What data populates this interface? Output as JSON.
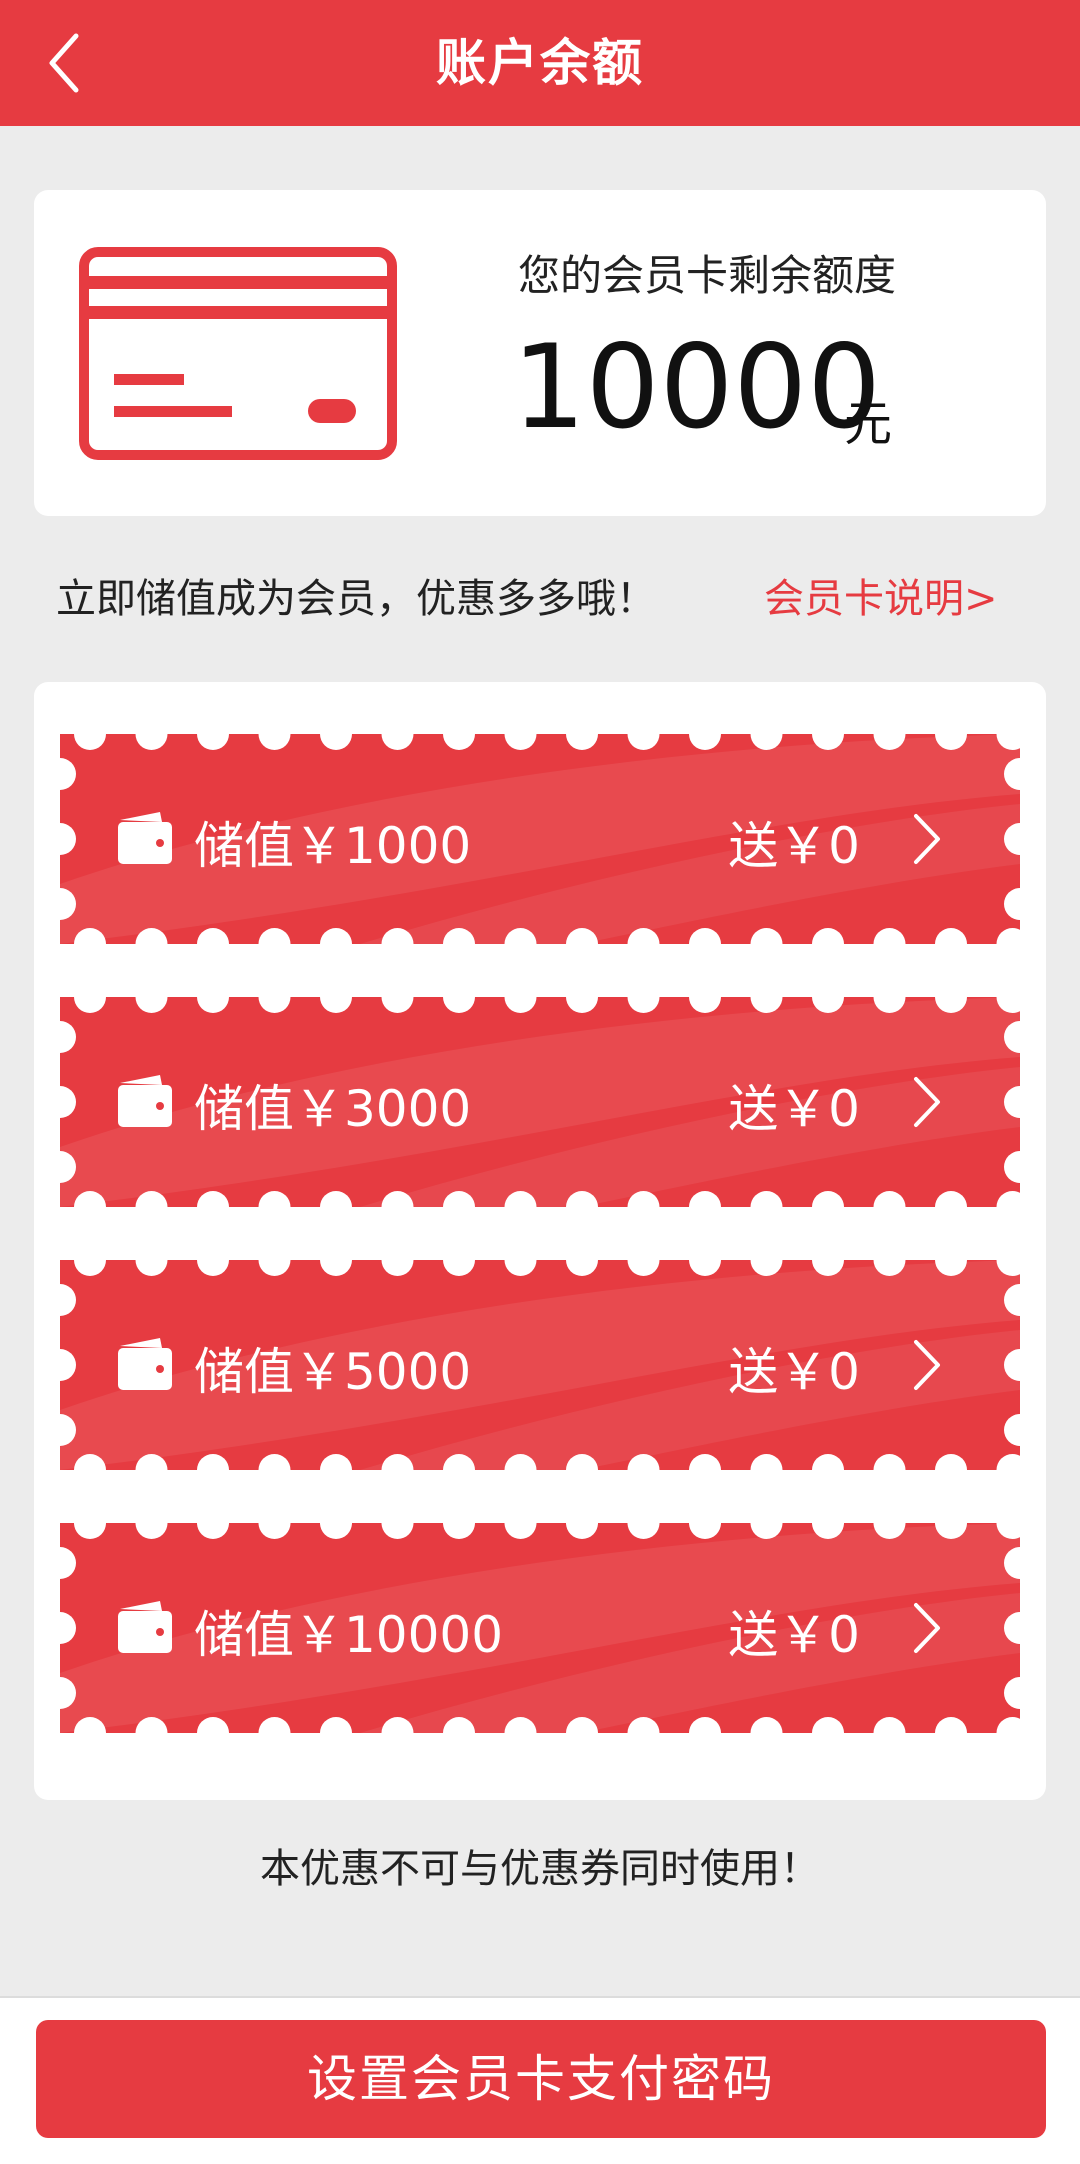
{
  "header": {
    "title": "账户余额"
  },
  "balance": {
    "label": "您的会员卡剩余额度",
    "amount": "10000",
    "unit": "元"
  },
  "promo": {
    "text": "立即储值成为会员，优惠多多哦！",
    "link": "会员卡说明>"
  },
  "options": [
    {
      "label": "储值￥1000",
      "bonus": "送￥0"
    },
    {
      "label": "储值￥3000",
      "bonus": "送￥0"
    },
    {
      "label": "储值￥5000",
      "bonus": "送￥0"
    },
    {
      "label": "储值￥10000",
      "bonus": "送￥0"
    }
  ],
  "notice": "本优惠不可与优惠券同时使用！",
  "footer": {
    "button_label": "设置会员卡支付密码"
  },
  "colors": {
    "accent": "#e63b41",
    "background": "#ececec"
  },
  "icons": [
    "back-icon",
    "credit-card-icon",
    "wallet-icon",
    "chevron-right-icon"
  ]
}
